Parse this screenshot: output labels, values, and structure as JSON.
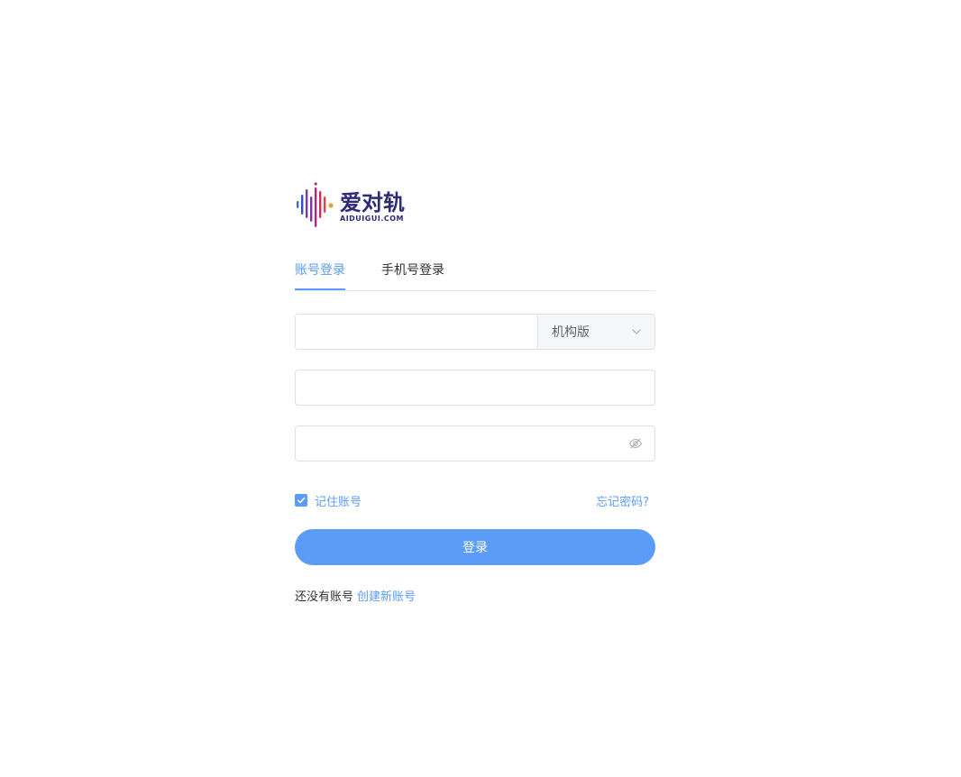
{
  "logo": {
    "name_cn": "爱对轨",
    "name_en": "AIDUIGUI.COM"
  },
  "tabs": [
    {
      "label": "账号登录",
      "active": true
    },
    {
      "label": "手机号登录",
      "active": false
    }
  ],
  "form": {
    "org_input": {
      "value": "",
      "placeholder": ""
    },
    "edition_select": {
      "selected": "机构版"
    },
    "account_input": {
      "value": "",
      "placeholder": ""
    },
    "password_input": {
      "value": "",
      "placeholder": ""
    }
  },
  "remember": {
    "label": "记住账号",
    "checked": true
  },
  "forgot_label": "忘记密码?",
  "login_button_label": "登录",
  "register": {
    "prompt": "还没有账号",
    "link_label": "创建新账号"
  },
  "colors": {
    "accent": "#5b9cf8",
    "text": "#303133",
    "border": "#dcdfe6"
  }
}
